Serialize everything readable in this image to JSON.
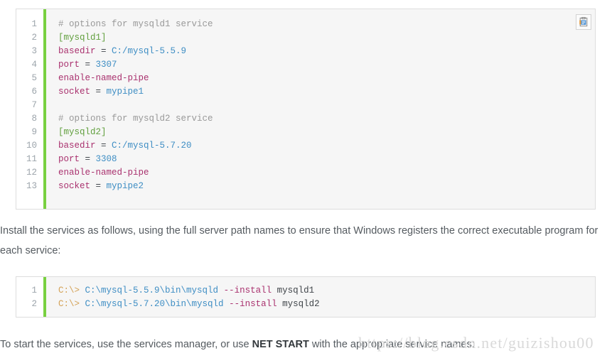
{
  "code_block_1": {
    "copy_button_label": "copy-to-clipboard",
    "line_numbers": [
      "1",
      "2",
      "3",
      "4",
      "5",
      "6",
      "7",
      "8",
      "9",
      "10",
      "11",
      "12",
      "13"
    ],
    "lines": [
      {
        "tokens": [
          {
            "text": "# options for mysqld1 service",
            "cls": "t-comment"
          }
        ]
      },
      {
        "tokens": [
          {
            "text": "[mysqld1]",
            "cls": "t-section"
          }
        ]
      },
      {
        "tokens": [
          {
            "text": "basedir",
            "cls": "t-key"
          },
          {
            "text": " = ",
            "cls": "t-op"
          },
          {
            "text": "C:/mysql-5.5.9",
            "cls": "t-val"
          }
        ]
      },
      {
        "tokens": [
          {
            "text": "port",
            "cls": "t-key"
          },
          {
            "text": " = ",
            "cls": "t-op"
          },
          {
            "text": "3307",
            "cls": "t-val"
          }
        ]
      },
      {
        "tokens": [
          {
            "text": "enable-named-pipe",
            "cls": "t-key"
          }
        ]
      },
      {
        "tokens": [
          {
            "text": "socket",
            "cls": "t-key"
          },
          {
            "text": " = ",
            "cls": "t-op"
          },
          {
            "text": "mypipe1",
            "cls": "t-val"
          }
        ]
      },
      {
        "tokens": [
          {
            "text": "",
            "cls": "t-plain"
          }
        ]
      },
      {
        "tokens": [
          {
            "text": "# options for mysqld2 service",
            "cls": "t-comment"
          }
        ]
      },
      {
        "tokens": [
          {
            "text": "[mysqld2]",
            "cls": "t-section"
          }
        ]
      },
      {
        "tokens": [
          {
            "text": "basedir",
            "cls": "t-key"
          },
          {
            "text": " = ",
            "cls": "t-op"
          },
          {
            "text": "C:/mysql-5.7.20",
            "cls": "t-val"
          }
        ]
      },
      {
        "tokens": [
          {
            "text": "port",
            "cls": "t-key"
          },
          {
            "text": " = ",
            "cls": "t-op"
          },
          {
            "text": "3308",
            "cls": "t-val"
          }
        ]
      },
      {
        "tokens": [
          {
            "text": "enable-named-pipe",
            "cls": "t-key"
          }
        ]
      },
      {
        "tokens": [
          {
            "text": "socket",
            "cls": "t-key"
          },
          {
            "text": " = ",
            "cls": "t-op"
          },
          {
            "text": "mypipe2",
            "cls": "t-val"
          }
        ]
      }
    ]
  },
  "paragraph_1": {
    "text": "Install the services as follows, using the full server path names to ensure that Windows registers the correct executable program for each service:"
  },
  "code_block_2": {
    "line_numbers": [
      "1",
      "2"
    ],
    "lines": [
      {
        "tokens": [
          {
            "text": "C:\\> ",
            "cls": "t-prompt"
          },
          {
            "text": "C:\\mysql-5.5.9\\bin\\mysqld",
            "cls": "t-path"
          },
          {
            "text": " ",
            "cls": "t-plain"
          },
          {
            "text": "--install",
            "cls": "t-flag"
          },
          {
            "text": " mysqld1",
            "cls": "t-plain"
          }
        ]
      },
      {
        "tokens": [
          {
            "text": "C:\\> ",
            "cls": "t-prompt"
          },
          {
            "text": "C:\\mysql-5.7.20\\bin\\mysqld",
            "cls": "t-path"
          },
          {
            "text": " ",
            "cls": "t-plain"
          },
          {
            "text": "--install",
            "cls": "t-flag"
          },
          {
            "text": " mysqld2",
            "cls": "t-plain"
          }
        ]
      }
    ]
  },
  "paragraph_2": {
    "part_1": "To start the services, use the services manager, or use ",
    "bold": "NET START",
    "part_2": " with the appropriate service names:"
  },
  "watermark": {
    "text": "https://blog.csdn.net/guizishou00"
  },
  "colors": {
    "accent_green": "#78d040",
    "code_background": "#f6f6f6",
    "code_border": "#dddddd",
    "text": "#555b60",
    "comment": "#999999",
    "section": "#62a03f",
    "key": "#a9316e",
    "value": "#3f8ec4",
    "prompt": "#d4a257"
  }
}
